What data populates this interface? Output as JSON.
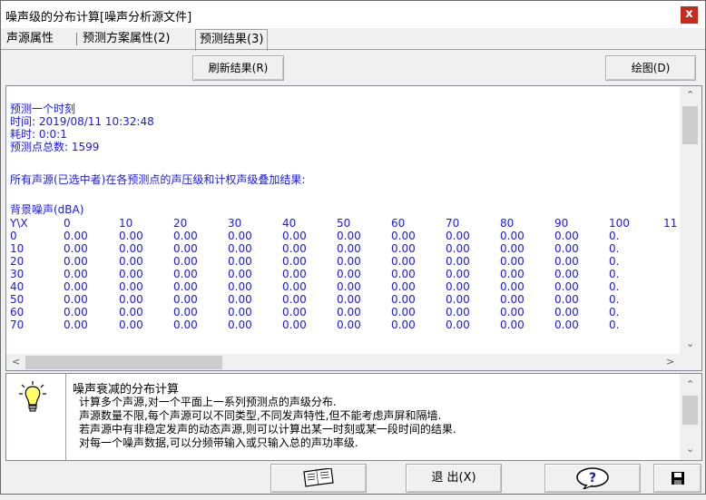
{
  "window": {
    "title": "噪声级的分布计算[噪声分析源文件]",
    "close_label": "x"
  },
  "tabs": [
    {
      "label": "声源属性"
    },
    {
      "label": "预测方案属性(2)"
    },
    {
      "label": "预测结果(3)"
    }
  ],
  "toolbar": {
    "refresh_label": "刷新结果(R)",
    "draw_label": "绘图(D)"
  },
  "output": {
    "lines": [
      "预测一个时刻",
      "时间: 2019/08/11 10:32:48",
      "耗时: 0:0:1",
      "预测点总数: 1599",
      "所有声源(已选中者)在各预测点的声压级和计权声级叠加结果:",
      "背景噪声(dBA)"
    ],
    "table": {
      "corner": "Y\\X",
      "columns": [
        "0",
        "10",
        "20",
        "30",
        "40",
        "50",
        "60",
        "70",
        "80",
        "90",
        "100",
        "11"
      ],
      "rows": [
        {
          "y": "0",
          "values": [
            "0.00",
            "0.00",
            "0.00",
            "0.00",
            "0.00",
            "0.00",
            "0.00",
            "0.00",
            "0.00",
            "0.00",
            "0."
          ]
        },
        {
          "y": "10",
          "values": [
            "0.00",
            "0.00",
            "0.00",
            "0.00",
            "0.00",
            "0.00",
            "0.00",
            "0.00",
            "0.00",
            "0.00",
            "0."
          ]
        },
        {
          "y": "20",
          "values": [
            "0.00",
            "0.00",
            "0.00",
            "0.00",
            "0.00",
            "0.00",
            "0.00",
            "0.00",
            "0.00",
            "0.00",
            "0."
          ]
        },
        {
          "y": "30",
          "values": [
            "0.00",
            "0.00",
            "0.00",
            "0.00",
            "0.00",
            "0.00",
            "0.00",
            "0.00",
            "0.00",
            "0.00",
            "0."
          ]
        },
        {
          "y": "40",
          "values": [
            "0.00",
            "0.00",
            "0.00",
            "0.00",
            "0.00",
            "0.00",
            "0.00",
            "0.00",
            "0.00",
            "0.00",
            "0."
          ]
        },
        {
          "y": "50",
          "values": [
            "0.00",
            "0.00",
            "0.00",
            "0.00",
            "0.00",
            "0.00",
            "0.00",
            "0.00",
            "0.00",
            "0.00",
            "0."
          ]
        },
        {
          "y": "60",
          "values": [
            "0.00",
            "0.00",
            "0.00",
            "0.00",
            "0.00",
            "0.00",
            "0.00",
            "0.00",
            "0.00",
            "0.00",
            "0."
          ]
        },
        {
          "y": "70",
          "values": [
            "0.00",
            "0.00",
            "0.00",
            "0.00",
            "0.00",
            "0.00",
            "0.00",
            "0.00",
            "0.00",
            "0.00",
            "0."
          ]
        }
      ]
    }
  },
  "info": {
    "icon": "lightbulb-icon",
    "title": "噪声衰减的分布计算",
    "lines": [
      "计算多个声源,对一个平面上一系列预测点的声级分布.",
      "声源数量不限,每个声源可以不同类型,不同发声特性,但不能考虑声屏和隔墙.",
      "若声源中有非稳定发声的动态声源,则可以计算出某一时刻或某一段时间的结果.",
      "对每一个噪声数据,可以分频带输入或只输入总的声功率级."
    ]
  },
  "bottom": {
    "book_icon": "book-icon",
    "exit_label": "退 出(X)",
    "help_icon": "help-icon",
    "save_icon": "save-icon"
  },
  "colors": {
    "output_text": "#1a1ae6",
    "close_button": "#c42b1c"
  }
}
